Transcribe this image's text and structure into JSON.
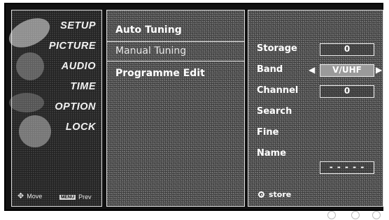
{
  "sidebar": {
    "items": [
      {
        "label": "SETUP"
      },
      {
        "label": "PICTURE"
      },
      {
        "label": "AUDIO"
      },
      {
        "label": "TIME"
      },
      {
        "label": "OPTION"
      },
      {
        "label": "LOCK"
      }
    ],
    "footer": {
      "move_icon": "move-cross-icon",
      "move_label": "Move",
      "menu_key": "MENU",
      "prev_label": "Prev"
    }
  },
  "submenu": {
    "options": [
      {
        "label": "Auto Tuning",
        "selected": false
      },
      {
        "label": "Manual Tuning",
        "selected": true
      },
      {
        "label": "Programme Edit",
        "selected": false
      }
    ]
  },
  "settings": {
    "storage": {
      "label": "Storage",
      "value": "0"
    },
    "band": {
      "label": "Band",
      "value": "V/UHF"
    },
    "channel": {
      "label": "Channel",
      "value": "0"
    },
    "search": {
      "label": "Search"
    },
    "fine": {
      "label": "Fine"
    },
    "name": {
      "label": "Name",
      "value": "- - - - -"
    },
    "store_label": "store"
  },
  "colors": {
    "text": "#ffffff",
    "band_highlight": "#9a9a9a"
  }
}
